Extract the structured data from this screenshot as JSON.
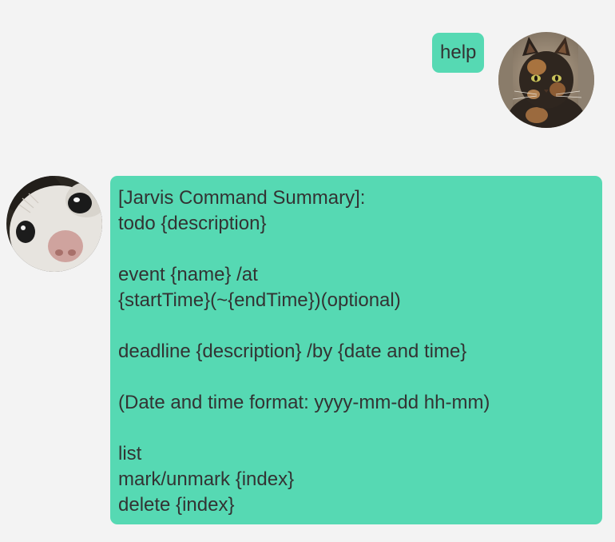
{
  "colors": {
    "background": "#f3f3f3",
    "bubble": "#56d9b3",
    "text": "#333333"
  },
  "user_message": {
    "text": "help",
    "avatar_icon": "tortoiseshell-cat-avatar"
  },
  "bot_message": {
    "avatar_icon": "white-kitten-closeup-avatar",
    "lines": [
      "[Jarvis Command Summary]:",
      "todo {description}",
      "",
      "event {name} /at",
      "{startTime}(~{endTime})(optional)",
      "",
      "deadline {description} /by {date and time}",
      "",
      "(Date and time format: yyyy-mm-dd hh-mm)",
      "",
      "list",
      "mark/unmark {index}",
      "delete {index}"
    ]
  }
}
